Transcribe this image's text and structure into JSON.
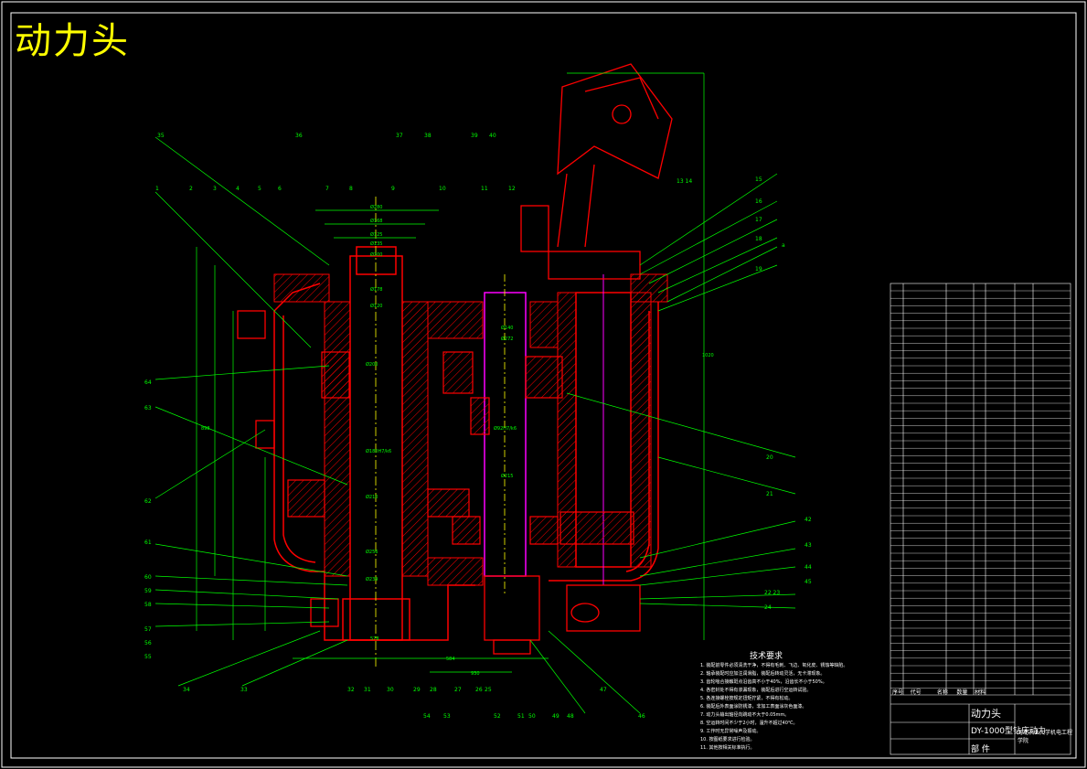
{
  "drawing": {
    "title": "动力头",
    "title_block": {
      "name": "动力头",
      "subtitle": "DY-1000型钻床动力",
      "type_label": "部 件",
      "org": "河北农业大学机电工程学院"
    },
    "tech_requirements_title": "技术要求",
    "tech_requirements": [
      "1. 装配前零件必须清洗干净，不得有毛刺、飞边、氧化皮、锈蚀等缺陷。",
      "2. 轴承装配时应加注润滑脂，装配后转动灵活，无卡滞现象。",
      "3. 齿轮啮合接触斑点沿齿高不小于40%，沿齿长不小于50%。",
      "4. 各密封处不得有渗漏现象，装配后进行空运转试验。",
      "5. 各连接螺栓按规定扭矩拧紧，不得有松动。",
      "6. 装配后外表面涂防锈漆，非加工表面涂灰色面漆。",
      "7. 动力头输出轴径向跳动不大于0.05mm。",
      "8. 空运转时间不少于2小时，温升不超过40℃。",
      "9. 工作时无异常噪声及振动。",
      "10. 按图纸要求进行检验。",
      "11. 其他按相关标准执行。"
    ],
    "bom_header": [
      "序号",
      "代号",
      "名称",
      "数量",
      "材料"
    ],
    "left_labels": [
      "64",
      "63",
      "62",
      "61",
      "60",
      "59",
      "58",
      "57",
      "56",
      "55"
    ],
    "top_labels": [
      "35",
      "1",
      "2",
      "3",
      "4",
      "5",
      "6",
      "36",
      "7",
      "8",
      "9",
      "37",
      "38",
      "10",
      "11",
      "39",
      "40",
      "12",
      "13 14",
      "15",
      "16",
      "17",
      "18",
      "19",
      "a"
    ],
    "right_labels": [
      "20",
      "21",
      "42",
      "43",
      "44",
      "45",
      "22 23",
      "24"
    ],
    "bottom_labels": [
      "34",
      "33",
      "32",
      "31",
      "30",
      "29",
      "28",
      "27",
      "26",
      "25",
      "54",
      "53",
      "52",
      "51",
      "50",
      "49",
      "48",
      "47",
      "46"
    ],
    "dims": [
      "Ø280",
      "Ø168",
      "Ø125",
      "Ø135",
      "Ø200",
      "Ø178",
      "Ø120",
      "Ø272",
      "Ø92H7/k6",
      "Ø140",
      "Ø200",
      "Ø215",
      "Ø180H7/k6",
      "Ø210",
      "Ø256",
      "Ø239",
      "578",
      "584",
      "930",
      "898",
      "1020"
    ],
    "colors": {
      "bg": "#000000",
      "frame": "#ffffff",
      "outline": "#ff0000",
      "dim": "#00ff00",
      "centerline": "#ffff00",
      "shaft": "#ff00ff",
      "text": "#ffffff",
      "title": "#ffff00"
    }
  }
}
